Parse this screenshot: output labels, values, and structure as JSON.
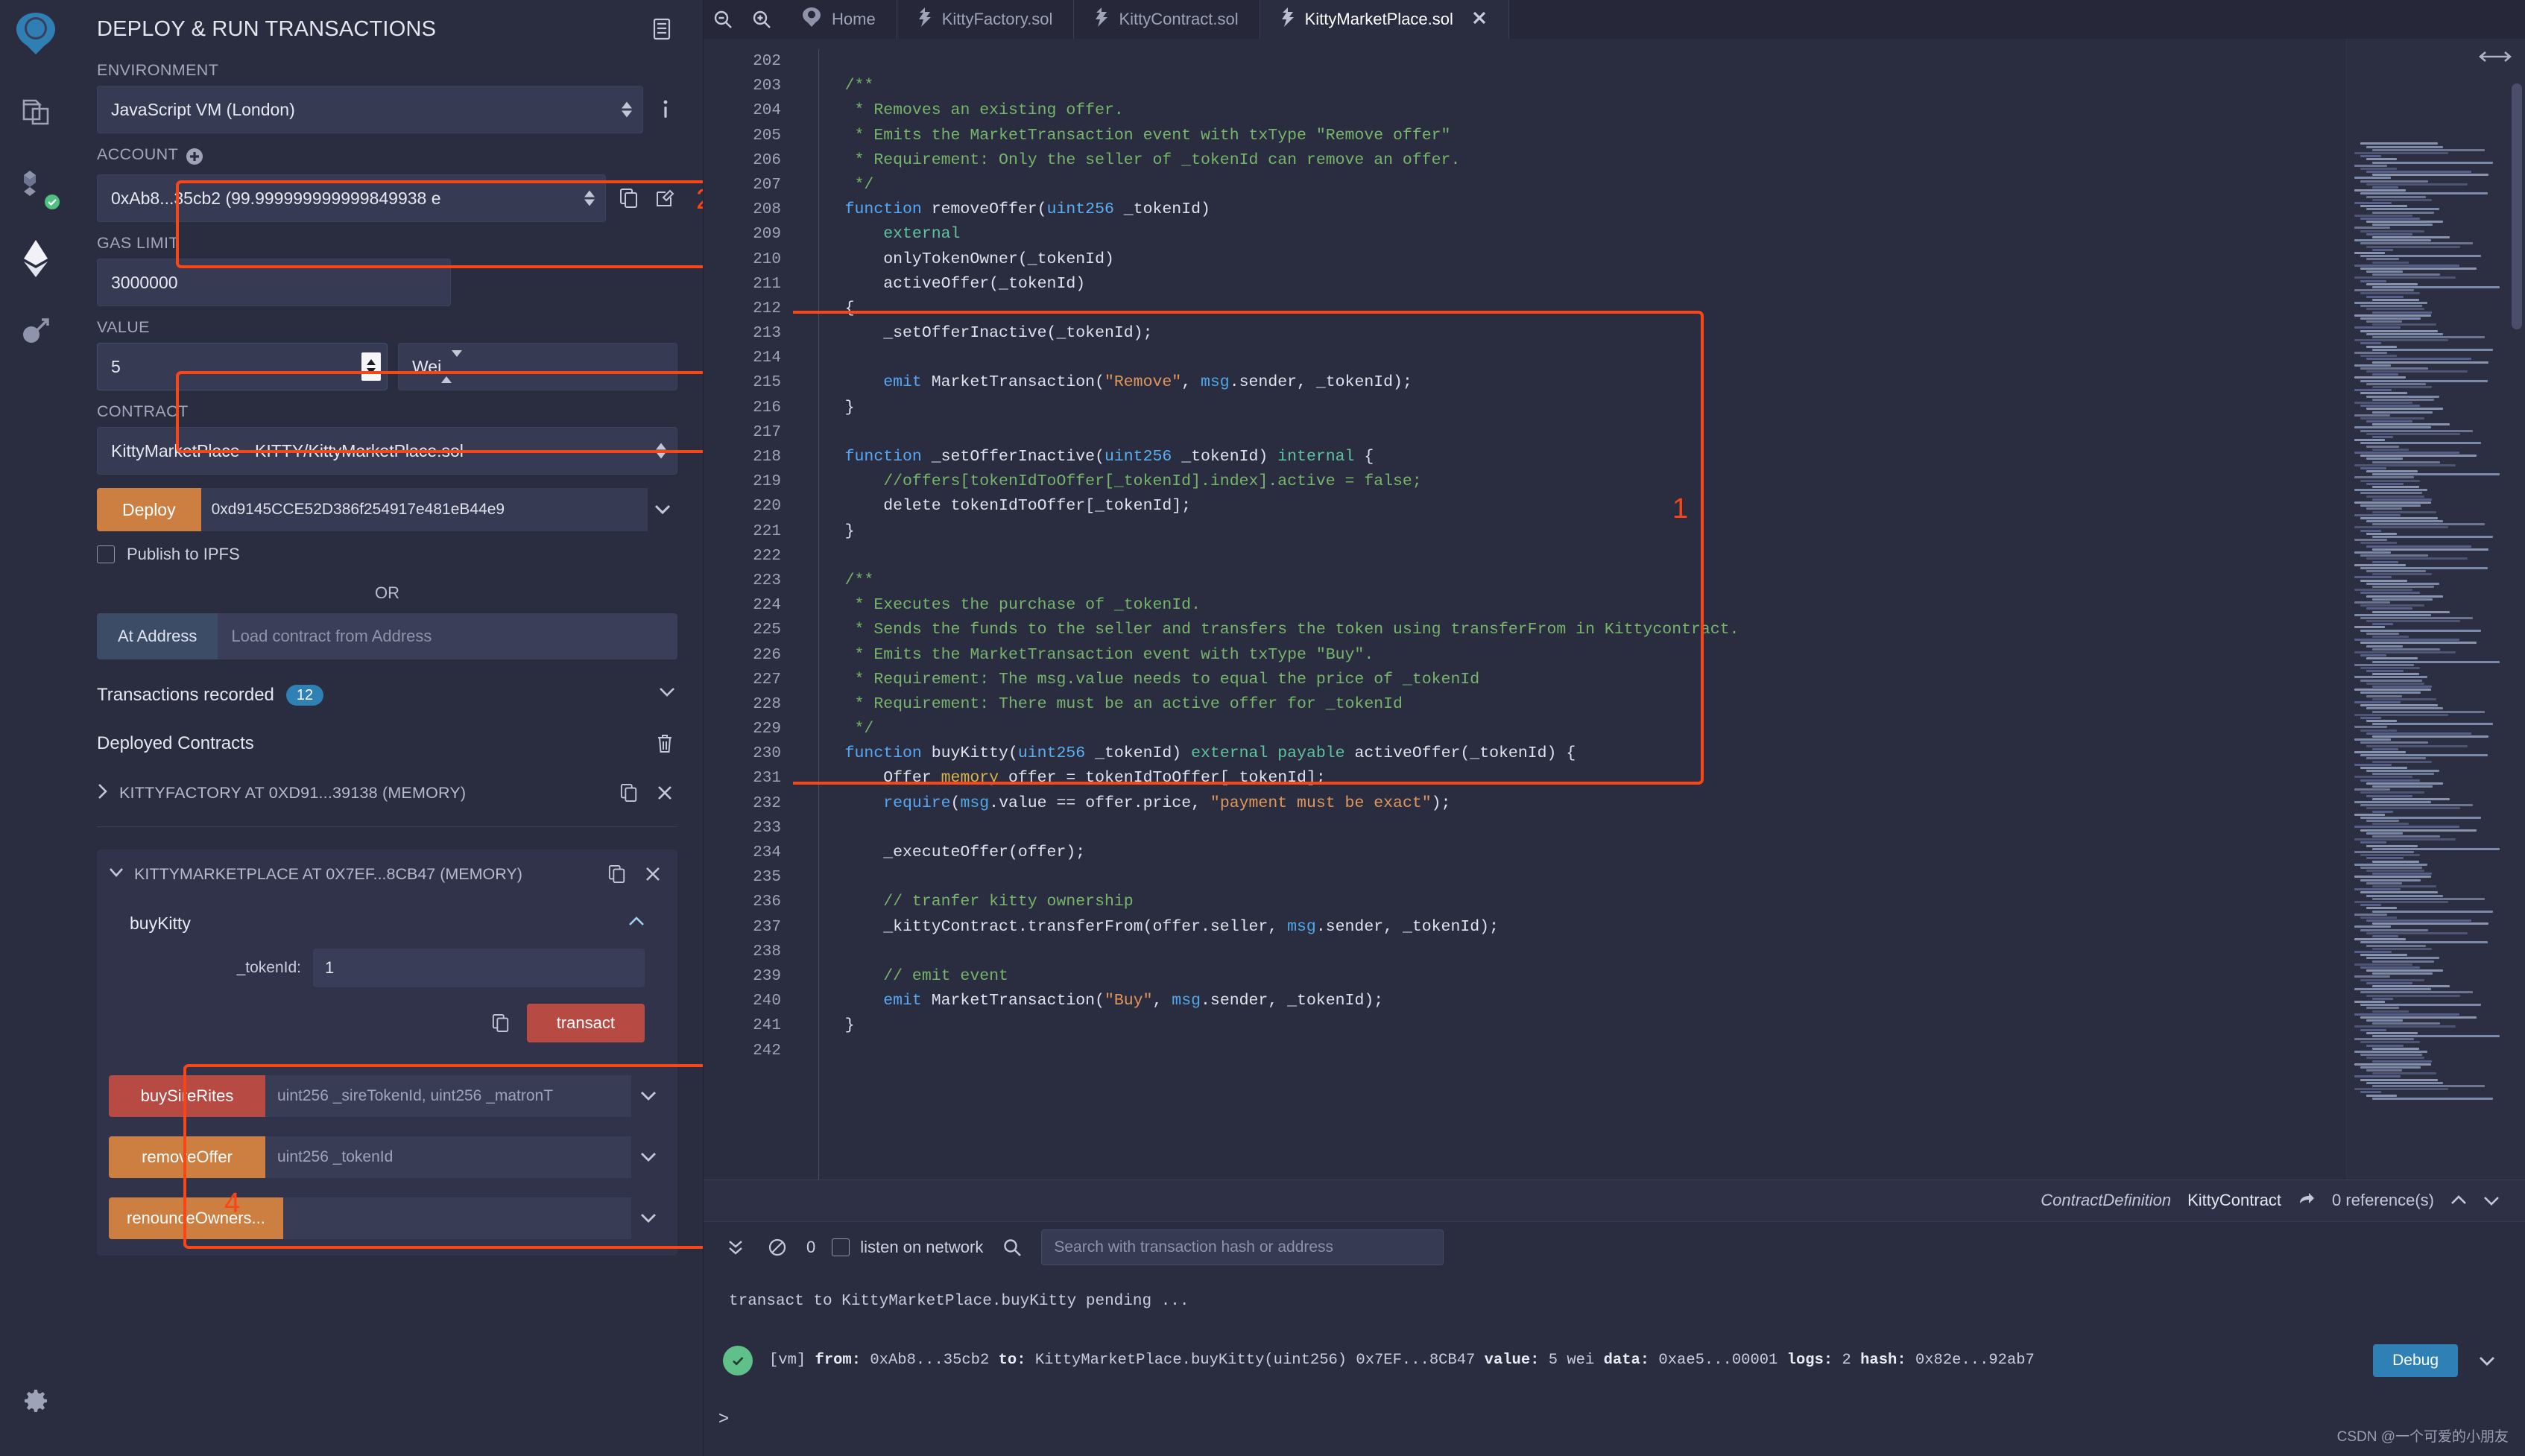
{
  "rail": {
    "icons": [
      {
        "name": "remix-logo-icon",
        "label": "Remix"
      },
      {
        "name": "file-explorer-icon",
        "label": "File explorers"
      },
      {
        "name": "solidity-compiler-icon",
        "label": "Solidity compiler"
      },
      {
        "name": "deploy-run-icon",
        "label": "Deploy & run transactions"
      },
      {
        "name": "plugin-manager-icon",
        "label": "Plugin manager"
      },
      {
        "name": "settings-gear-icon",
        "label": "Settings"
      }
    ]
  },
  "sidebar": {
    "title": "DEPLOY & RUN TRANSACTIONS",
    "panel_icon": "panel-toggle-icon",
    "environment": {
      "label": "ENVIRONMENT",
      "value": "JavaScript VM (London)",
      "info_icon": "info-icon"
    },
    "account": {
      "label": "ACCOUNT",
      "plus_icon": "plus-circle-icon",
      "value": "0xAb8...35cb2 (99.999999999999849938 e",
      "copy_icon": "copy-icon",
      "edit_icon": "edit-icon"
    },
    "gas_limit": {
      "label": "GAS LIMIT",
      "value": "3000000"
    },
    "value": {
      "label": "VALUE",
      "amount": "5",
      "unit": "Wei"
    },
    "contract": {
      "label": "CONTRACT",
      "value": "KittyMarketPlace - KITTY/KittyMarketPlace.sol"
    },
    "deploy": {
      "button_label": "Deploy",
      "address": "0xd9145CCE52D386f254917e481eB44e9",
      "caret_icon": "chevron-down-icon"
    },
    "publish_ipfs": {
      "label": "Publish to IPFS",
      "checked": false
    },
    "or_label": "OR",
    "at_address": {
      "button_label": "At Address",
      "placeholder": "Load contract from Address"
    },
    "transactions_recorded": {
      "label": "Transactions recorded",
      "count": "12",
      "caret_icon": "chevron-down-icon"
    },
    "deployed_contracts": {
      "title": "Deployed Contracts",
      "trash_icon": "trash-icon",
      "items": [
        {
          "name": "KITTYFACTORY AT 0XD91...39138 (MEMORY)",
          "expanded": false,
          "caret_icon": "chevron-right-icon",
          "copy_icon": "copy-icon",
          "close_icon": "close-icon"
        },
        {
          "name": "KITTYMARKETPLACE AT 0X7EF...8CB47 (MEMORY)",
          "expanded": true,
          "caret_icon": "chevron-down-icon",
          "copy_icon": "copy-icon",
          "close_icon": "close-icon"
        }
      ]
    },
    "expanded_function": {
      "name": "buyKitty",
      "collapse_icon": "chevron-up-icon",
      "arg_label": "_tokenId:",
      "arg_value": "1",
      "copy_icon": "copy-calldata-icon",
      "transact_label": "transact"
    },
    "functions": [
      {
        "name": "buySireRites",
        "signature": "uint256 _sireTokenId, uint256 _matronT",
        "color": "#b74a43",
        "caret_icon": "chevron-down-icon"
      },
      {
        "name": "removeOffer",
        "signature": "uint256 _tokenId",
        "color": "#cd7f41",
        "caret_icon": "chevron-down-icon"
      },
      {
        "name": "renounceOwners...",
        "signature": "",
        "color": "#cd7f41",
        "caret_icon": "chevron-down-icon"
      }
    ]
  },
  "tabs": {
    "zoom_out_icon": "zoom-out-icon",
    "zoom_in_icon": "zoom-in-icon",
    "items": [
      {
        "label": "Home",
        "icon": "remix-home-icon",
        "active": false,
        "closable": false
      },
      {
        "label": "KittyFactory.sol",
        "icon": "solidity-file-icon",
        "active": false,
        "closable": false
      },
      {
        "label": "KittyContract.sol",
        "icon": "solidity-file-icon",
        "active": false,
        "closable": false
      },
      {
        "label": "KittyMarketPlace.sol",
        "icon": "solidity-file-icon",
        "active": true,
        "closable": true
      }
    ]
  },
  "editor": {
    "first_line": 202,
    "highlight_start_line": 223,
    "highlight_end_line": 241,
    "lines": [
      {
        "n": 202,
        "tokens": []
      },
      {
        "n": 203,
        "tokens": [
          {
            "t": "    ",
            "c": "pl"
          },
          {
            "t": "/**",
            "c": "cm"
          }
        ]
      },
      {
        "n": 204,
        "tokens": [
          {
            "t": "     ",
            "c": "pl"
          },
          {
            "t": "* Removes an existing offer.",
            "c": "cm"
          }
        ]
      },
      {
        "n": 205,
        "tokens": [
          {
            "t": "     ",
            "c": "pl"
          },
          {
            "t": "* Emits the MarketTransaction event with txType \"Remove offer\"",
            "c": "cm"
          }
        ]
      },
      {
        "n": 206,
        "tokens": [
          {
            "t": "     ",
            "c": "pl"
          },
          {
            "t": "* Requirement: Only the seller of _tokenId can remove an offer.",
            "c": "cm"
          }
        ]
      },
      {
        "n": 207,
        "tokens": [
          {
            "t": "     ",
            "c": "pl"
          },
          {
            "t": "*/",
            "c": "cm"
          }
        ]
      },
      {
        "n": 208,
        "tokens": [
          {
            "t": "    ",
            "c": "pl"
          },
          {
            "t": "function",
            "c": "kw"
          },
          {
            "t": " removeOffer(",
            "c": "pl"
          },
          {
            "t": "uint256",
            "c": "ty"
          },
          {
            "t": " _tokenId)",
            "c": "pl"
          }
        ]
      },
      {
        "n": 209,
        "tokens": [
          {
            "t": "        ",
            "c": "pl"
          },
          {
            "t": "external",
            "c": "mod"
          }
        ]
      },
      {
        "n": 210,
        "tokens": [
          {
            "t": "        onlyTokenOwner(_tokenId)",
            "c": "pl"
          }
        ]
      },
      {
        "n": 211,
        "tokens": [
          {
            "t": "        activeOffer(_tokenId)",
            "c": "pl"
          }
        ]
      },
      {
        "n": 212,
        "tokens": [
          {
            "t": "    {",
            "c": "pl"
          }
        ]
      },
      {
        "n": 213,
        "tokens": [
          {
            "t": "        _setOfferInactive(_tokenId);",
            "c": "pl"
          }
        ]
      },
      {
        "n": 214,
        "tokens": []
      },
      {
        "n": 215,
        "tokens": [
          {
            "t": "        ",
            "c": "pl"
          },
          {
            "t": "emit",
            "c": "kw"
          },
          {
            "t": " MarketTransaction(",
            "c": "pl"
          },
          {
            "t": "\"Remove\"",
            "c": "str"
          },
          {
            "t": ", ",
            "c": "pl"
          },
          {
            "t": "msg",
            "c": "msg"
          },
          {
            "t": ".sender, _tokenId);",
            "c": "pl"
          }
        ]
      },
      {
        "n": 216,
        "tokens": [
          {
            "t": "    }",
            "c": "pl"
          }
        ]
      },
      {
        "n": 217,
        "tokens": []
      },
      {
        "n": 218,
        "tokens": [
          {
            "t": "    ",
            "c": "pl"
          },
          {
            "t": "function",
            "c": "kw"
          },
          {
            "t": " _setOfferInactive(",
            "c": "pl"
          },
          {
            "t": "uint256",
            "c": "ty"
          },
          {
            "t": " _tokenId) ",
            "c": "pl"
          },
          {
            "t": "internal",
            "c": "mod"
          },
          {
            "t": " {",
            "c": "pl"
          }
        ]
      },
      {
        "n": 219,
        "tokens": [
          {
            "t": "        ",
            "c": "pl"
          },
          {
            "t": "//offers[tokenIdToOffer[_tokenId].index].active = false;",
            "c": "cm"
          }
        ]
      },
      {
        "n": 220,
        "tokens": [
          {
            "t": "        delete tokenIdToOffer[_tokenId];",
            "c": "pl"
          }
        ]
      },
      {
        "n": 221,
        "tokens": [
          {
            "t": "    }",
            "c": "pl"
          }
        ]
      },
      {
        "n": 222,
        "tokens": []
      },
      {
        "n": 223,
        "tokens": [
          {
            "t": "    ",
            "c": "pl"
          },
          {
            "t": "/**",
            "c": "cm"
          }
        ]
      },
      {
        "n": 224,
        "tokens": [
          {
            "t": "     ",
            "c": "pl"
          },
          {
            "t": "* Executes the purchase of _tokenId.",
            "c": "cm"
          }
        ]
      },
      {
        "n": 225,
        "tokens": [
          {
            "t": "     ",
            "c": "pl"
          },
          {
            "t": "* Sends the funds to the seller and transfers the token using transferFrom in Kittycontract.",
            "c": "cm"
          }
        ]
      },
      {
        "n": 226,
        "tokens": [
          {
            "t": "     ",
            "c": "pl"
          },
          {
            "t": "* Emits the MarketTransaction event with txType \"Buy\".",
            "c": "cm"
          }
        ]
      },
      {
        "n": 227,
        "tokens": [
          {
            "t": "     ",
            "c": "pl"
          },
          {
            "t": "* Requirement: The msg.value needs to equal the price of _tokenId",
            "c": "cm"
          }
        ]
      },
      {
        "n": 228,
        "tokens": [
          {
            "t": "     ",
            "c": "pl"
          },
          {
            "t": "* Requirement: There must be an active offer for _tokenId",
            "c": "cm"
          }
        ]
      },
      {
        "n": 229,
        "tokens": [
          {
            "t": "     ",
            "c": "pl"
          },
          {
            "t": "*/",
            "c": "cm"
          }
        ]
      },
      {
        "n": 230,
        "tokens": [
          {
            "t": "    ",
            "c": "pl"
          },
          {
            "t": "function",
            "c": "kw"
          },
          {
            "t": " buyKitty(",
            "c": "pl"
          },
          {
            "t": "uint256",
            "c": "ty"
          },
          {
            "t": " _tokenId) ",
            "c": "pl"
          },
          {
            "t": "external",
            "c": "mod"
          },
          {
            "t": " ",
            "c": "pl"
          },
          {
            "t": "payable",
            "c": "mod"
          },
          {
            "t": " activeOffer(_tokenId) {",
            "c": "pl"
          }
        ]
      },
      {
        "n": 231,
        "tokens": [
          {
            "t": "        Offer ",
            "c": "pl"
          },
          {
            "t": "memory",
            "c": "mem"
          },
          {
            "t": " offer = tokenIdToOffer[_tokenId];",
            "c": "pl"
          }
        ]
      },
      {
        "n": 232,
        "tokens": [
          {
            "t": "        ",
            "c": "pl"
          },
          {
            "t": "require",
            "c": "kw"
          },
          {
            "t": "(",
            "c": "pl"
          },
          {
            "t": "msg",
            "c": "msg"
          },
          {
            "t": ".value == offer.price, ",
            "c": "pl"
          },
          {
            "t": "\"payment must be exact\"",
            "c": "str"
          },
          {
            "t": ");",
            "c": "pl"
          }
        ]
      },
      {
        "n": 233,
        "tokens": []
      },
      {
        "n": 234,
        "tokens": [
          {
            "t": "        _executeOffer(offer);",
            "c": "pl"
          }
        ]
      },
      {
        "n": 235,
        "tokens": []
      },
      {
        "n": 236,
        "tokens": [
          {
            "t": "        ",
            "c": "pl"
          },
          {
            "t": "// tranfer kitty ownership",
            "c": "cm"
          }
        ]
      },
      {
        "n": 237,
        "tokens": [
          {
            "t": "        _kittyContract.transferFrom(offer.seller, ",
            "c": "pl"
          },
          {
            "t": "msg",
            "c": "msg"
          },
          {
            "t": ".sender, _tokenId);",
            "c": "pl"
          }
        ]
      },
      {
        "n": 238,
        "tokens": []
      },
      {
        "n": 239,
        "tokens": [
          {
            "t": "        ",
            "c": "pl"
          },
          {
            "t": "// emit event",
            "c": "cm"
          }
        ]
      },
      {
        "n": 240,
        "tokens": [
          {
            "t": "        ",
            "c": "pl"
          },
          {
            "t": "emit",
            "c": "kw"
          },
          {
            "t": " MarketTransaction(",
            "c": "pl"
          },
          {
            "t": "\"Buy\"",
            "c": "str"
          },
          {
            "t": ", ",
            "c": "pl"
          },
          {
            "t": "msg",
            "c": "msg"
          },
          {
            "t": ".sender, _tokenId);",
            "c": "pl"
          }
        ]
      },
      {
        "n": 241,
        "tokens": [
          {
            "t": "    }",
            "c": "pl"
          }
        ]
      },
      {
        "n": 242,
        "tokens": []
      }
    ]
  },
  "statusbar": {
    "kind": "ContractDefinition",
    "name": "KittyContract",
    "goto_icon": "goto-reference-icon",
    "references": "0 reference(s)",
    "up_icon": "chevron-up-icon",
    "down_icon": "chevron-down-icon"
  },
  "terminal": {
    "collapse_icon": "double-chevron-down-icon",
    "clear_icon": "clear-console-icon",
    "pending_count": "0",
    "listen_label": "listen on network",
    "listen_checked": false,
    "search_icon": "search-icon",
    "search_placeholder": "Search with transaction hash or address",
    "log_pending": "transact to KittyMarketPlace.buyKitty pending ...",
    "tx": {
      "status_icon": "check-circle-icon",
      "vm": "[vm]",
      "from_label": "from:",
      "from": "0xAb8...35cb2",
      "to_label": "to:",
      "to": "KittyMarketPlace.buyKitty(uint256) 0x7EF...8CB47",
      "value_label": "value:",
      "value": "5 wei",
      "data_label": "data:",
      "data": "0xae5...00001",
      "logs_label": "logs:",
      "logs": "2",
      "hash_label": "hash:",
      "hash": "0x82e...92ab7",
      "debug_label": "Debug",
      "expand_icon": "chevron-down-icon"
    },
    "prompt": ">"
  },
  "annotations": [
    {
      "id": "1",
      "target": "editor-buykitty-block"
    },
    {
      "id": "2",
      "target": "account-field"
    },
    {
      "id": "3",
      "target": "value-field"
    },
    {
      "id": "4",
      "target": "buykitty-function-box"
    }
  ],
  "watermark": "CSDN @一个可爱的小朋友",
  "colors": {
    "accent_orange": "#cd7f41",
    "accent_red": "#b74a43",
    "accent_blue": "#2f80b5",
    "highlight": "#fa4616",
    "panel_bg": "#2a2c3f",
    "input_bg": "#363a52"
  }
}
